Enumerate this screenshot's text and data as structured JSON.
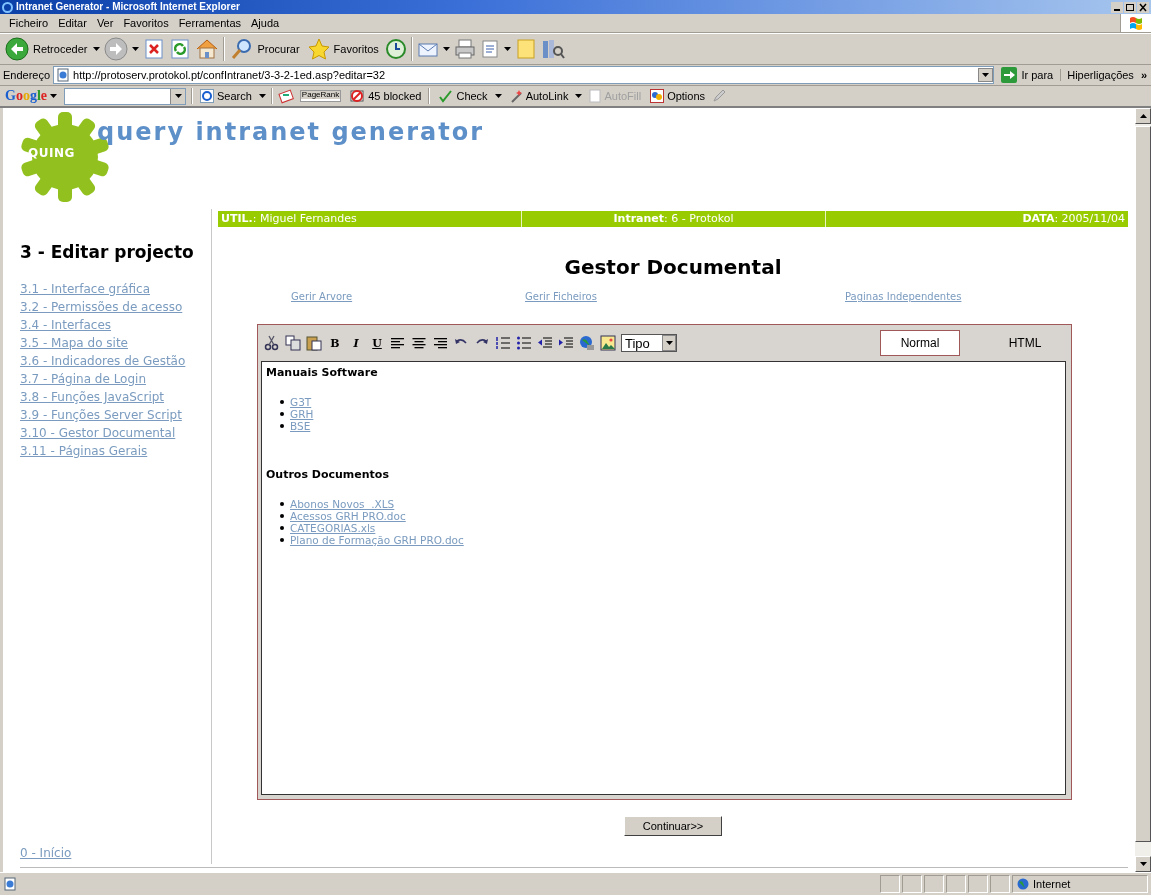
{
  "window": {
    "title": "Intranet Generator - Microsoft Internet Explorer"
  },
  "menu_bar": [
    "Ficheiro",
    "Editar",
    "Ver",
    "Favoritos",
    "Ferramentas",
    "Ajuda"
  ],
  "toolbar": {
    "back": "Retroceder",
    "search": "Procurar",
    "favorites": "Favoritos"
  },
  "address_bar": {
    "label": "Endereço",
    "url": "http://protoserv.protokol.pt/confIntranet/3-3-2-1ed.asp?editar=32",
    "go": "Ir para",
    "links": "Hiperligações",
    "more": "»"
  },
  "google_bar": {
    "logo": "Google",
    "search": "Search",
    "pagerank": "PageRank",
    "blocked": "45 blocked",
    "check": "Check",
    "autolink": "AutoLink",
    "autofill": {
      "label": "AutoFill",
      "disabled": true
    },
    "options": "Options"
  },
  "header": {
    "badge": "QUING",
    "title": "query intranet generator"
  },
  "info_bar": [
    {
      "text": "**UTIL.**: Miguel Fernandes"
    },
    {
      "text": "**Intranet**: 6 - Protokol"
    },
    {
      "text": "**DATA**: 2005/11/04"
    }
  ],
  "sidebar": {
    "heading": "3 - Editar projecto",
    "items": [
      "3.1 - Interface gráfica",
      "3.2 - Permissões de acesso",
      "3.4 - Interfaces",
      "3.5 - Mapa do site",
      "3.6 - Indicadores de Gestão",
      "3.7 - Página de Login",
      "3.8 - Funções JavaScript",
      "3.9 - Funções Server Script",
      "3.10 - Gestor Documental",
      "3.11 - Páginas Gerais"
    ],
    "home": "0 - Início"
  },
  "main": {
    "title": "Gestor Documental",
    "links": [
      "Gerir Arvore",
      "Gerir Ficheiros",
      "Paginas Independentes"
    ],
    "editor": {
      "style_buttons": [
        {
          "label": "B",
          "kind": "bold"
        },
        {
          "label": "I",
          "kind": "italic"
        },
        {
          "label": "U",
          "kind": "underline"
        }
      ],
      "format": "Tipo",
      "modes": [
        {
          "label": "Normal",
          "selected": true
        },
        {
          "label": "HTML",
          "selected": false
        }
      ],
      "sections": [
        {
          "heading": "Manuais Software",
          "links": [
            "G3T",
            "GRH",
            "BSE"
          ]
        },
        {
          "heading": "Outros Documentos",
          "links": [
            "Abonos Novos  .XLS",
            "Acessos GRH PRO.doc",
            "CATEGORIAS.xls",
            "Plano de Formação GRH PRO.doc"
          ]
        }
      ]
    },
    "continue_button": "Continuar>>"
  },
  "status_bar": {
    "zone": "Internet"
  }
}
